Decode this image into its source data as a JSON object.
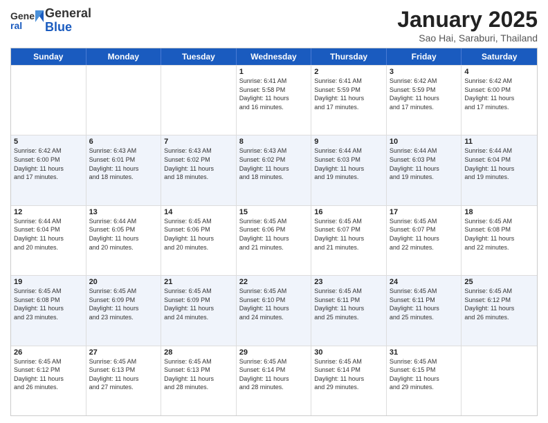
{
  "logo": {
    "general": "General",
    "blue": "Blue"
  },
  "header": {
    "month": "January 2025",
    "location": "Sao Hai, Saraburi, Thailand"
  },
  "weekdays": [
    "Sunday",
    "Monday",
    "Tuesday",
    "Wednesday",
    "Thursday",
    "Friday",
    "Saturday"
  ],
  "rows": [
    [
      {
        "day": "",
        "info": ""
      },
      {
        "day": "",
        "info": ""
      },
      {
        "day": "",
        "info": ""
      },
      {
        "day": "1",
        "info": "Sunrise: 6:41 AM\nSunset: 5:58 PM\nDaylight: 11 hours\nand 16 minutes."
      },
      {
        "day": "2",
        "info": "Sunrise: 6:41 AM\nSunset: 5:59 PM\nDaylight: 11 hours\nand 17 minutes."
      },
      {
        "day": "3",
        "info": "Sunrise: 6:42 AM\nSunset: 5:59 PM\nDaylight: 11 hours\nand 17 minutes."
      },
      {
        "day": "4",
        "info": "Sunrise: 6:42 AM\nSunset: 6:00 PM\nDaylight: 11 hours\nand 17 minutes."
      }
    ],
    [
      {
        "day": "5",
        "info": "Sunrise: 6:42 AM\nSunset: 6:00 PM\nDaylight: 11 hours\nand 17 minutes."
      },
      {
        "day": "6",
        "info": "Sunrise: 6:43 AM\nSunset: 6:01 PM\nDaylight: 11 hours\nand 18 minutes."
      },
      {
        "day": "7",
        "info": "Sunrise: 6:43 AM\nSunset: 6:02 PM\nDaylight: 11 hours\nand 18 minutes."
      },
      {
        "day": "8",
        "info": "Sunrise: 6:43 AM\nSunset: 6:02 PM\nDaylight: 11 hours\nand 18 minutes."
      },
      {
        "day": "9",
        "info": "Sunrise: 6:44 AM\nSunset: 6:03 PM\nDaylight: 11 hours\nand 19 minutes."
      },
      {
        "day": "10",
        "info": "Sunrise: 6:44 AM\nSunset: 6:03 PM\nDaylight: 11 hours\nand 19 minutes."
      },
      {
        "day": "11",
        "info": "Sunrise: 6:44 AM\nSunset: 6:04 PM\nDaylight: 11 hours\nand 19 minutes."
      }
    ],
    [
      {
        "day": "12",
        "info": "Sunrise: 6:44 AM\nSunset: 6:04 PM\nDaylight: 11 hours\nand 20 minutes."
      },
      {
        "day": "13",
        "info": "Sunrise: 6:44 AM\nSunset: 6:05 PM\nDaylight: 11 hours\nand 20 minutes."
      },
      {
        "day": "14",
        "info": "Sunrise: 6:45 AM\nSunset: 6:06 PM\nDaylight: 11 hours\nand 20 minutes."
      },
      {
        "day": "15",
        "info": "Sunrise: 6:45 AM\nSunset: 6:06 PM\nDaylight: 11 hours\nand 21 minutes."
      },
      {
        "day": "16",
        "info": "Sunrise: 6:45 AM\nSunset: 6:07 PM\nDaylight: 11 hours\nand 21 minutes."
      },
      {
        "day": "17",
        "info": "Sunrise: 6:45 AM\nSunset: 6:07 PM\nDaylight: 11 hours\nand 22 minutes."
      },
      {
        "day": "18",
        "info": "Sunrise: 6:45 AM\nSunset: 6:08 PM\nDaylight: 11 hours\nand 22 minutes."
      }
    ],
    [
      {
        "day": "19",
        "info": "Sunrise: 6:45 AM\nSunset: 6:08 PM\nDaylight: 11 hours\nand 23 minutes."
      },
      {
        "day": "20",
        "info": "Sunrise: 6:45 AM\nSunset: 6:09 PM\nDaylight: 11 hours\nand 23 minutes."
      },
      {
        "day": "21",
        "info": "Sunrise: 6:45 AM\nSunset: 6:09 PM\nDaylight: 11 hours\nand 24 minutes."
      },
      {
        "day": "22",
        "info": "Sunrise: 6:45 AM\nSunset: 6:10 PM\nDaylight: 11 hours\nand 24 minutes."
      },
      {
        "day": "23",
        "info": "Sunrise: 6:45 AM\nSunset: 6:11 PM\nDaylight: 11 hours\nand 25 minutes."
      },
      {
        "day": "24",
        "info": "Sunrise: 6:45 AM\nSunset: 6:11 PM\nDaylight: 11 hours\nand 25 minutes."
      },
      {
        "day": "25",
        "info": "Sunrise: 6:45 AM\nSunset: 6:12 PM\nDaylight: 11 hours\nand 26 minutes."
      }
    ],
    [
      {
        "day": "26",
        "info": "Sunrise: 6:45 AM\nSunset: 6:12 PM\nDaylight: 11 hours\nand 26 minutes."
      },
      {
        "day": "27",
        "info": "Sunrise: 6:45 AM\nSunset: 6:13 PM\nDaylight: 11 hours\nand 27 minutes."
      },
      {
        "day": "28",
        "info": "Sunrise: 6:45 AM\nSunset: 6:13 PM\nDaylight: 11 hours\nand 28 minutes."
      },
      {
        "day": "29",
        "info": "Sunrise: 6:45 AM\nSunset: 6:14 PM\nDaylight: 11 hours\nand 28 minutes."
      },
      {
        "day": "30",
        "info": "Sunrise: 6:45 AM\nSunset: 6:14 PM\nDaylight: 11 hours\nand 29 minutes."
      },
      {
        "day": "31",
        "info": "Sunrise: 6:45 AM\nSunset: 6:15 PM\nDaylight: 11 hours\nand 29 minutes."
      },
      {
        "day": "",
        "info": ""
      }
    ]
  ]
}
